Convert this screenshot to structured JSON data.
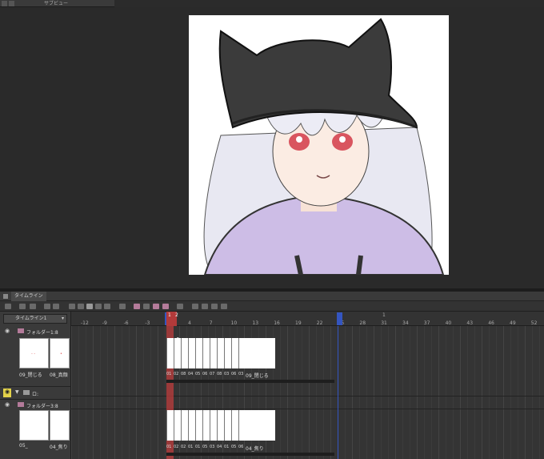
{
  "subview": {
    "tab_title": "サブビュー"
  },
  "timeline": {
    "panel_title": "タイムライン",
    "selector_label": "タイムライン1",
    "playhead_markers": [
      "1",
      "2"
    ],
    "ruler_top_mark": "1",
    "ruler_ticks": [
      "-12",
      "-9",
      "-6",
      "-3",
      "1",
      "4",
      "7",
      "10",
      "13",
      "16",
      "19",
      "22",
      "25",
      "28",
      "31",
      "34",
      "37",
      "40",
      "43",
      "46",
      "49",
      "52"
    ],
    "layers": [
      {
        "name": "フォルダー1:8",
        "thumb_labels": [
          "09_閉じる",
          "08_真顔"
        ]
      },
      {
        "name": "ロ:",
        "thumb_labels": []
      },
      {
        "name": "フォルダー3:8",
        "thumb_labels": [
          "05_",
          "04_焦り"
        ]
      }
    ],
    "row1_cel_labels": [
      "01",
      "02",
      "08",
      "04",
      "05",
      "06",
      "07",
      "08",
      "03",
      "06",
      "03"
    ],
    "row1_last_label": "09_閉じる",
    "row3_cel_labels": [
      "01",
      "02",
      "02",
      "01",
      "01",
      "05",
      "03",
      "04",
      "01",
      "05",
      "06"
    ],
    "row3_last_label": "04_焦り"
  }
}
